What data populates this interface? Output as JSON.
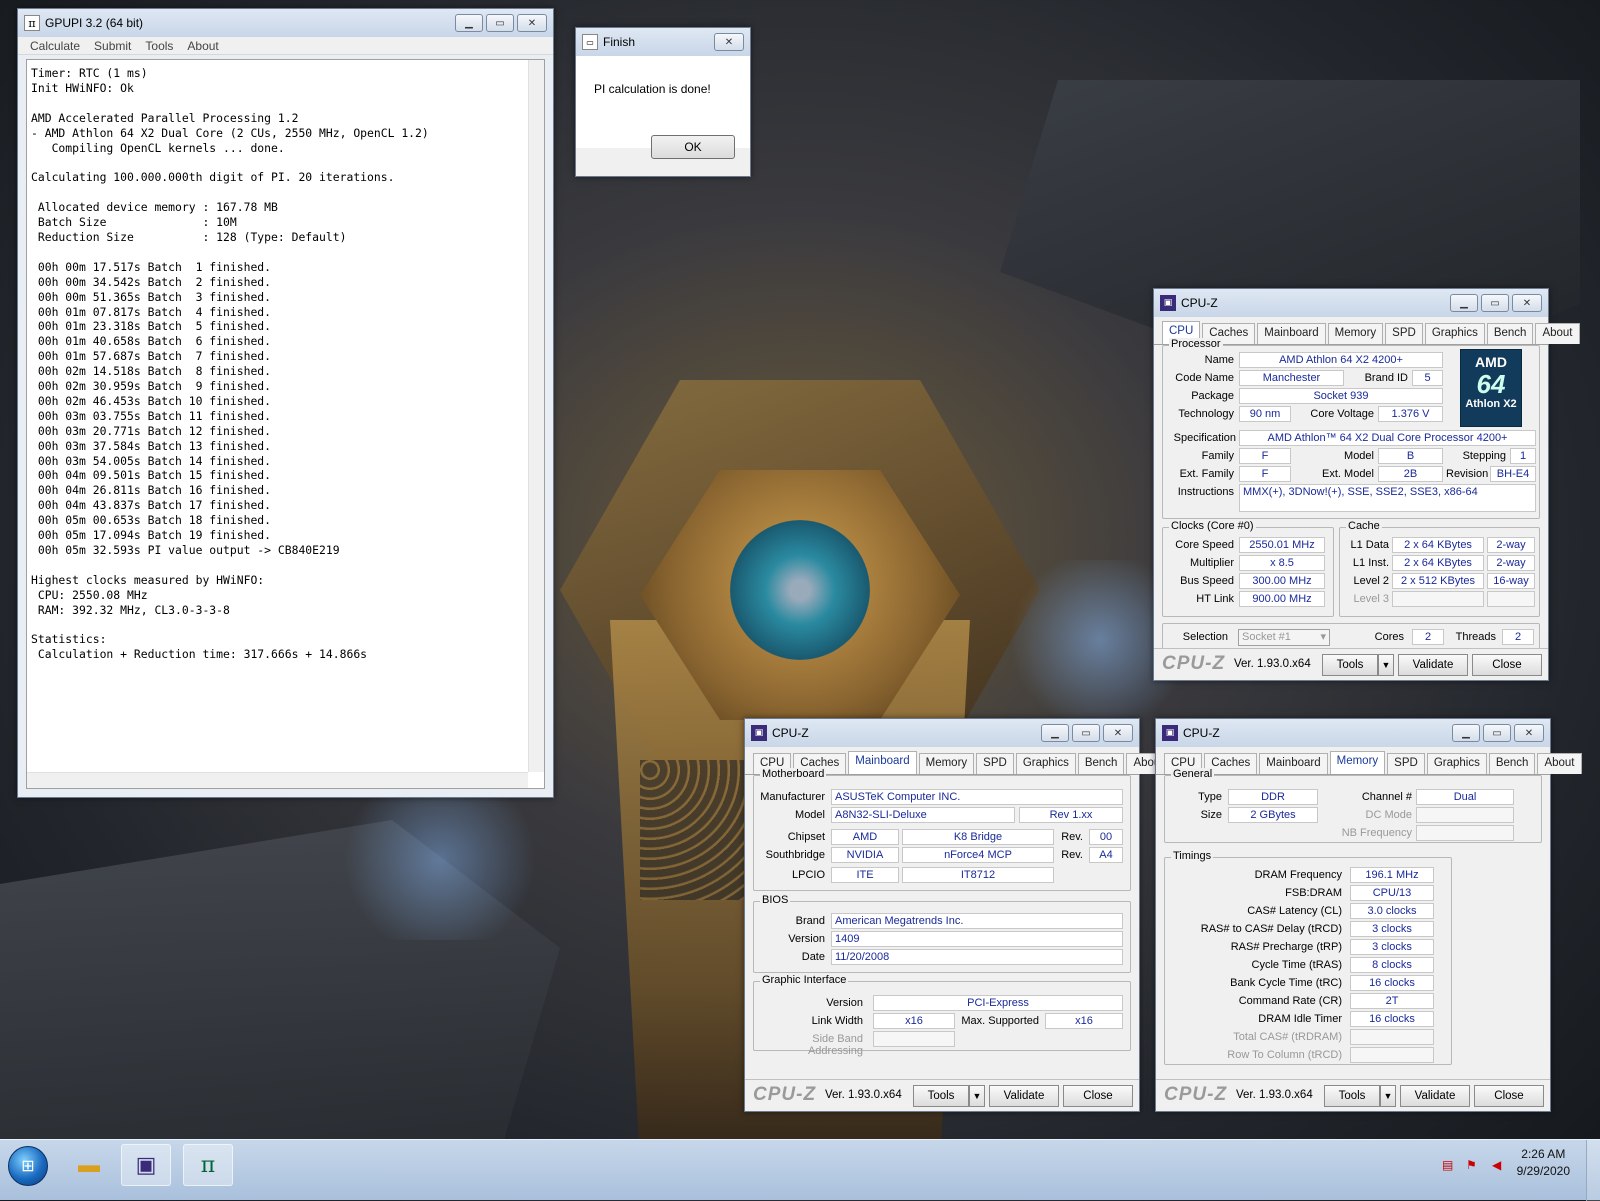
{
  "gpupi": {
    "title": "GPUPI 3.2 (64 bit)",
    "menu": [
      "Calculate",
      "Submit",
      "Tools",
      "About"
    ],
    "console_lines": [
      "Timer: RTC (1 ms)",
      "Init HWiNFO: Ok",
      "",
      "AMD Accelerated Parallel Processing 1.2",
      "- AMD Athlon 64 X2 Dual Core (2 CUs, 2550 MHz, OpenCL 1.2)",
      "   Compiling OpenCL kernels ... done.",
      "",
      "Calculating 100.000.000th digit of PI. 20 iterations.",
      "",
      " Allocated device memory : 167.78 MB",
      " Batch Size              : 10M",
      " Reduction Size          : 128 (Type: Default)",
      "",
      " 00h 00m 17.517s Batch  1 finished.",
      " 00h 00m 34.542s Batch  2 finished.",
      " 00h 00m 51.365s Batch  3 finished.",
      " 00h 01m 07.817s Batch  4 finished.",
      " 00h 01m 23.318s Batch  5 finished.",
      " 00h 01m 40.658s Batch  6 finished.",
      " 00h 01m 57.687s Batch  7 finished.",
      " 00h 02m 14.518s Batch  8 finished.",
      " 00h 02m 30.959s Batch  9 finished.",
      " 00h 02m 46.453s Batch 10 finished.",
      " 00h 03m 03.755s Batch 11 finished.",
      " 00h 03m 20.771s Batch 12 finished.",
      " 00h 03m 37.584s Batch 13 finished.",
      " 00h 03m 54.005s Batch 14 finished.",
      " 00h 04m 09.501s Batch 15 finished.",
      " 00h 04m 26.811s Batch 16 finished.",
      " 00h 04m 43.837s Batch 17 finished.",
      " 00h 05m 00.653s Batch 18 finished.",
      " 00h 05m 17.094s Batch 19 finished.",
      " 00h 05m 32.593s PI value output -> CB840E219",
      "",
      "Highest clocks measured by HWiNFO:",
      " CPU: 2550.08 MHz",
      " RAM: 392.32 MHz, CL3.0-3-3-8",
      "",
      "Statistics:",
      " Calculation + Reduction time: 317.666s + 14.866s"
    ]
  },
  "finish": {
    "title": "Finish",
    "message": "PI calculation is done!",
    "ok_label": "OK"
  },
  "cpuz_tabs": [
    "CPU",
    "Caches",
    "Mainboard",
    "Memory",
    "SPD",
    "Graphics",
    "Bench",
    "About"
  ],
  "cpuz_common": {
    "title": "CPU-Z",
    "logo": "CPU-Z",
    "version": "Ver. 1.93.0.x64",
    "tools": "Tools",
    "validate": "Validate",
    "close": "Close"
  },
  "cpu": {
    "processor_group": "Processor",
    "name_label": "Name",
    "name": "AMD Athlon 64 X2 4200+",
    "codename_label": "Code Name",
    "codename": "Manchester",
    "brandid_label": "Brand ID",
    "brandid": "5",
    "package_label": "Package",
    "package": "Socket 939",
    "tech_label": "Technology",
    "tech": "90 nm",
    "voltage_label": "Core Voltage",
    "voltage": "1.376 V",
    "spec_label": "Specification",
    "spec": "AMD Athlon™ 64 X2 Dual Core Processor 4200+",
    "family_label": "Family",
    "family": "F",
    "model_label": "Model",
    "model": "B",
    "stepping_label": "Stepping",
    "stepping": "1",
    "extfamily_label": "Ext. Family",
    "extfamily": "F",
    "extmodel_label": "Ext. Model",
    "extmodel": "2B",
    "revision_label": "Revision",
    "revision": "BH-E4",
    "instr_label": "Instructions",
    "instr": "MMX(+), 3DNow!(+), SSE, SSE2, SSE3, x86-64",
    "logo_brand": "AMD",
    "logo_mark": "64",
    "logo_line": "Athlon X2",
    "clocks_group": "Clocks (Core #0)",
    "corespeed_label": "Core Speed",
    "corespeed": "2550.01 MHz",
    "mult_label": "Multiplier",
    "mult": "x 8.5",
    "bus_label": "Bus Speed",
    "bus": "300.00 MHz",
    "ht_label": "HT Link",
    "ht": "900.00 MHz",
    "cache_group": "Cache",
    "l1d_label": "L1 Data",
    "l1d": "2 x 64 KBytes",
    "l1d_way": "2-way",
    "l1i_label": "L1 Inst.",
    "l1i": "2 x 64 KBytes",
    "l1i_way": "2-way",
    "l2_label": "Level 2",
    "l2": "2 x 512 KBytes",
    "l2_way": "16-way",
    "l3_label": "Level 3",
    "selection_label": "Selection",
    "selection": "Socket #1",
    "cores_label": "Cores",
    "cores": "2",
    "threads_label": "Threads",
    "threads": "2"
  },
  "mainboard": {
    "mb_group": "Motherboard",
    "manu_label": "Manufacturer",
    "manu": "ASUSTeK Computer INC.",
    "model_label": "Model",
    "model": "A8N32-SLI-Deluxe",
    "model_rev": "Rev 1.xx",
    "chipset_label": "Chipset",
    "chipset": "AMD",
    "chipset_name": "K8 Bridge",
    "rev_label": "Rev.",
    "chipset_rev": "00",
    "sb_label": "Southbridge",
    "sb": "NVIDIA",
    "sb_name": "nForce4 MCP",
    "sb_rev": "A4",
    "lpcio_label": "LPCIO",
    "lpcio": "ITE",
    "lpcio_name": "IT8712",
    "bios_group": "BIOS",
    "brand_label": "Brand",
    "brand": "American Megatrends Inc.",
    "version_label": "Version",
    "version": "1409",
    "date_label": "Date",
    "date": "11/20/2008",
    "gi_group": "Graphic Interface",
    "giver_label": "Version",
    "giver": "PCI-Express",
    "lw_label": "Link Width",
    "lw": "x16",
    "max_label": "Max. Supported",
    "max": "x16",
    "sba_label": "Side Band Addressing"
  },
  "memory": {
    "general_group": "General",
    "type_label": "Type",
    "type": "DDR",
    "channel_label": "Channel #",
    "channel": "Dual",
    "size_label": "Size",
    "size": "2 GBytes",
    "dc_label": "DC Mode",
    "nb_label": "NB Frequency",
    "timings_group": "Timings",
    "dram_label": "DRAM Frequency",
    "dram": "196.1 MHz",
    "fsb_label": "FSB:DRAM",
    "fsb": "CPU/13",
    "cas_label": "CAS# Latency (CL)",
    "cas": "3.0 clocks",
    "rcd_label": "RAS# to CAS# Delay (tRCD)",
    "rcd": "3 clocks",
    "rp_label": "RAS# Precharge (tRP)",
    "rp": "3 clocks",
    "ras_label": "Cycle Time (tRAS)",
    "ras": "8 clocks",
    "rc_label": "Bank Cycle Time (tRC)",
    "rc": "16 clocks",
    "cr_label": "Command Rate (CR)",
    "cr": "2T",
    "idle_label": "DRAM Idle Timer",
    "idle": "16 clocks",
    "tcas_label": "Total CAS# (tRDRAM)",
    "rtc_label": "Row To Column (tRCD)"
  },
  "taskbar": {
    "time": "2:26 AM",
    "date": "9/29/2020"
  }
}
